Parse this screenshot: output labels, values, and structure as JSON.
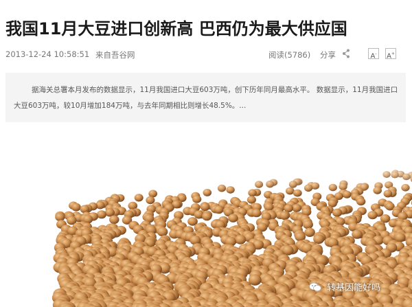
{
  "article": {
    "title": "我国11月大豆进口创新高 巴西仍为最大供应国",
    "date": "2013-12-24 10:58:51",
    "source": "来自吾谷网",
    "reads": "阅读(5786)",
    "share_label": "分享",
    "font_small_label": "A",
    "font_large_label": "A",
    "summary": "据海关总署本月发布的数据显示，11月我国进口大豆603万吨，创下历年同月最高水平。 数据显示，11月我国进口大豆603万吨，较10月增加184万吨，与去年同期相比则增长48.5%。..."
  },
  "watermark": {
    "text": "转基因能好吗",
    "icon": "wechat-icon"
  },
  "colors": {
    "title": "#1a1a1a",
    "meta": "#777777",
    "summary_bg": "#f4f4f4",
    "bean": "#c8874a"
  }
}
